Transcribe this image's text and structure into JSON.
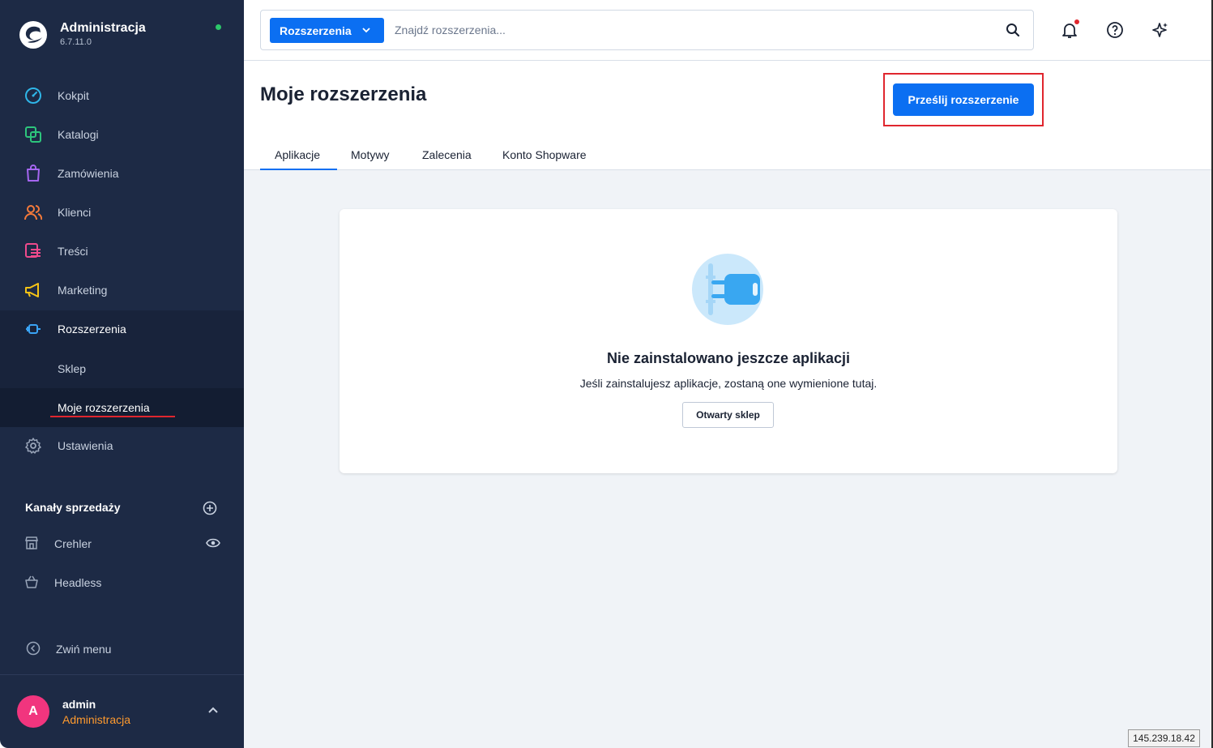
{
  "app": {
    "title": "Administracja",
    "version": "6.7.11.0"
  },
  "colors": {
    "sidebar_bg": "#1d2a45",
    "accent": "#0b6ff2",
    "online": "#2cc76a",
    "highlight": "#e0262e",
    "avatar": "#f1357e",
    "role": "#ff9a2e"
  },
  "sidebar": {
    "items": [
      {
        "label": "Kokpit",
        "icon": "dashboard-icon"
      },
      {
        "label": "Katalogi",
        "icon": "catalog-icon"
      },
      {
        "label": "Zamówienia",
        "icon": "bag-icon"
      },
      {
        "label": "Klienci",
        "icon": "customers-icon"
      },
      {
        "label": "Treści",
        "icon": "content-icon"
      },
      {
        "label": "Marketing",
        "icon": "megaphone-icon"
      },
      {
        "label": "Rozszerzenia",
        "icon": "plug-icon"
      },
      {
        "label": "Ustawienia",
        "icon": "gear-icon"
      }
    ],
    "subitems": [
      {
        "label": "Sklep"
      },
      {
        "label": "Moje rozszerzenia"
      }
    ],
    "channels_title": "Kanały sprzedaży",
    "channels": [
      {
        "label": "Crehler",
        "icon": "storefront-icon"
      },
      {
        "label": "Headless",
        "icon": "basket-icon"
      }
    ],
    "collapse_label": "Zwiń menu",
    "user": {
      "initial": "A",
      "name": "admin",
      "role": "Administracja"
    }
  },
  "search": {
    "type_label": "Rozszerzenia",
    "placeholder": "Znajdź rozszerzenia..."
  },
  "page": {
    "title": "Moje rozszerzenia",
    "upload_button": "Prześlij rozszerzenie",
    "tabs": [
      "Aplikacje",
      "Motywy",
      "Zalecenia",
      "Konto Shopware"
    ],
    "active_tab": "Aplikacje",
    "empty_state": {
      "title": "Nie zainstalowano jeszcze aplikacji",
      "subtitle": "Jeśli zainstalujesz aplikacje, zostaną one wymienione tutaj.",
      "button": "Otwarty sklep"
    }
  },
  "ip_badge": "145.239.18.42"
}
